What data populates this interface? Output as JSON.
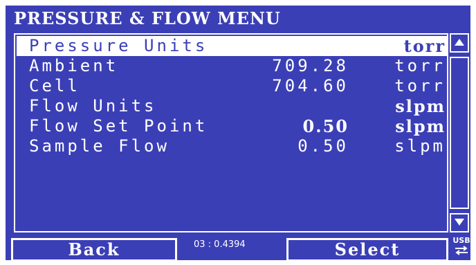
{
  "header": {
    "title": "PRESSURE & FLOW MENU"
  },
  "menu": {
    "rows": [
      {
        "label": "Pressure Units",
        "value": "",
        "unit": "torr",
        "selected": true
      },
      {
        "label": "Ambient",
        "value": "709.28",
        "unit": "torr"
      },
      {
        "label": "Cell",
        "value": "704.60",
        "unit": "torr"
      },
      {
        "label": "Flow Units",
        "value": "",
        "unit": "slpm"
      },
      {
        "label": "Flow Set Point",
        "value": "0.50",
        "unit": "slpm"
      },
      {
        "label": "Sample Flow",
        "value": "0.50",
        "unit": "slpm"
      }
    ]
  },
  "footer": {
    "back_label": "Back",
    "select_label": "Select",
    "status_text": "03 : 0.4394",
    "usb_label": "USB"
  },
  "colors": {
    "background": "#3b3fb6",
    "foreground": "#ffffff"
  },
  "icons": {
    "scroll_up": "triangle-up-icon",
    "scroll_down": "triangle-down-icon",
    "usb": "usb-arrows-icon"
  }
}
